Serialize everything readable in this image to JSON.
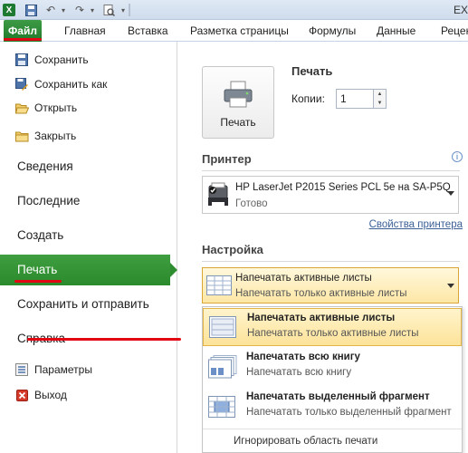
{
  "window": {
    "title": "EX"
  },
  "ribbon": {
    "tabs": [
      {
        "label": "Файл"
      },
      {
        "label": "Главная"
      },
      {
        "label": "Вставка"
      },
      {
        "label": "Разметка страницы"
      },
      {
        "label": "Формулы"
      },
      {
        "label": "Данные"
      },
      {
        "label": "Рецен"
      }
    ]
  },
  "nav": {
    "commands": [
      {
        "label": "Сохранить",
        "icon": "save-icon"
      },
      {
        "label": "Сохранить как",
        "icon": "save-as-icon"
      },
      {
        "label": "Открыть",
        "icon": "open-folder-icon"
      },
      {
        "label": "Закрыть",
        "icon": "close-folder-icon"
      }
    ],
    "tabs": [
      {
        "label": "Сведения"
      },
      {
        "label": "Последние"
      },
      {
        "label": "Создать"
      },
      {
        "label": "Печать",
        "active": true
      },
      {
        "label": "Сохранить и отправить"
      },
      {
        "label": "Справка"
      }
    ],
    "bottom": [
      {
        "label": "Параметры",
        "icon": "options-icon"
      },
      {
        "label": "Выход",
        "icon": "exit-icon"
      }
    ]
  },
  "print": {
    "heading": "Печать",
    "button_label": "Печать",
    "copies_label": "Копии:",
    "copies_value": "1"
  },
  "printer": {
    "heading": "Принтер",
    "name": "HP LaserJet P2015 Series PCL 5e на SA-P5Q",
    "status": "Готово",
    "properties_link": "Свойства принтера"
  },
  "settings": {
    "heading": "Настройка",
    "selected": {
      "title": "Напечатать активные листы",
      "subtitle": "Напечатать только активные листы"
    },
    "options": [
      {
        "title": "Напечатать активные листы",
        "subtitle": "Напечатать только активные листы",
        "selected": true
      },
      {
        "title": "Напечатать всю книгу",
        "subtitle": "Напечатать всю книгу"
      },
      {
        "title": "Напечатать выделенный фрагмент",
        "subtitle": "Напечатать только выделенный фрагмент"
      }
    ],
    "footer": "Игнорировать область печати"
  },
  "colors": {
    "accent_green": "#2a8a2c",
    "highlight_red": "#e30613",
    "selection_gold": "#fde39a"
  }
}
